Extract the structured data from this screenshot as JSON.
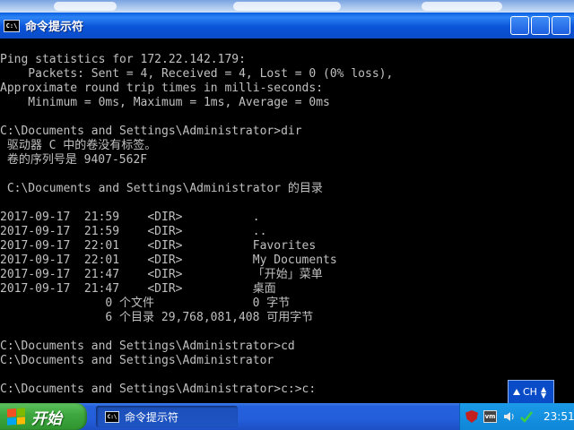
{
  "window": {
    "title": "命令提示符",
    "icon_text": "C:\\"
  },
  "console": {
    "lines": [
      "",
      "Ping statistics for 172.22.142.179:",
      "    Packets: Sent = 4, Received = 4, Lost = 0 (0% loss),",
      "Approximate round trip times in milli-seconds:",
      "    Minimum = 0ms, Maximum = 1ms, Average = 0ms",
      "",
      "C:\\Documents and Settings\\Administrator>dir",
      " 驱动器 C 中的卷没有标签。",
      " 卷的序列号是 9407-562F",
      "",
      " C:\\Documents and Settings\\Administrator 的目录",
      "",
      "2017-09-17  21:59    <DIR>          .",
      "2017-09-17  21:59    <DIR>          ..",
      "2017-09-17  22:01    <DIR>          Favorites",
      "2017-09-17  22:01    <DIR>          My Documents",
      "2017-09-17  21:47    <DIR>          「开始」菜单",
      "2017-09-17  21:47    <DIR>          桌面",
      "               0 个文件              0 字节",
      "               6 个目录 29,768,081,408 可用字节",
      "",
      "C:\\Documents and Settings\\Administrator>cd",
      "C:\\Documents and Settings\\Administrator",
      "",
      "C:\\Documents and Settings\\Administrator>c:>c:"
    ]
  },
  "language_bar": {
    "text": "CH",
    "up_arrow": "▲",
    "down_arrow": "▼"
  },
  "taskbar": {
    "start_label": "开始",
    "task_item_label": "命令提示符",
    "task_icon_text": "C:\\",
    "tray_vm_text": "vm",
    "clock": "23:51"
  },
  "colors": {
    "console_text": "#c0c0c0",
    "console_bg": "#000000",
    "titlebar": "#0a54d8",
    "taskbar": "#245edb",
    "start_green": "#3fa83f",
    "tray_blue": "#0f86d8"
  }
}
